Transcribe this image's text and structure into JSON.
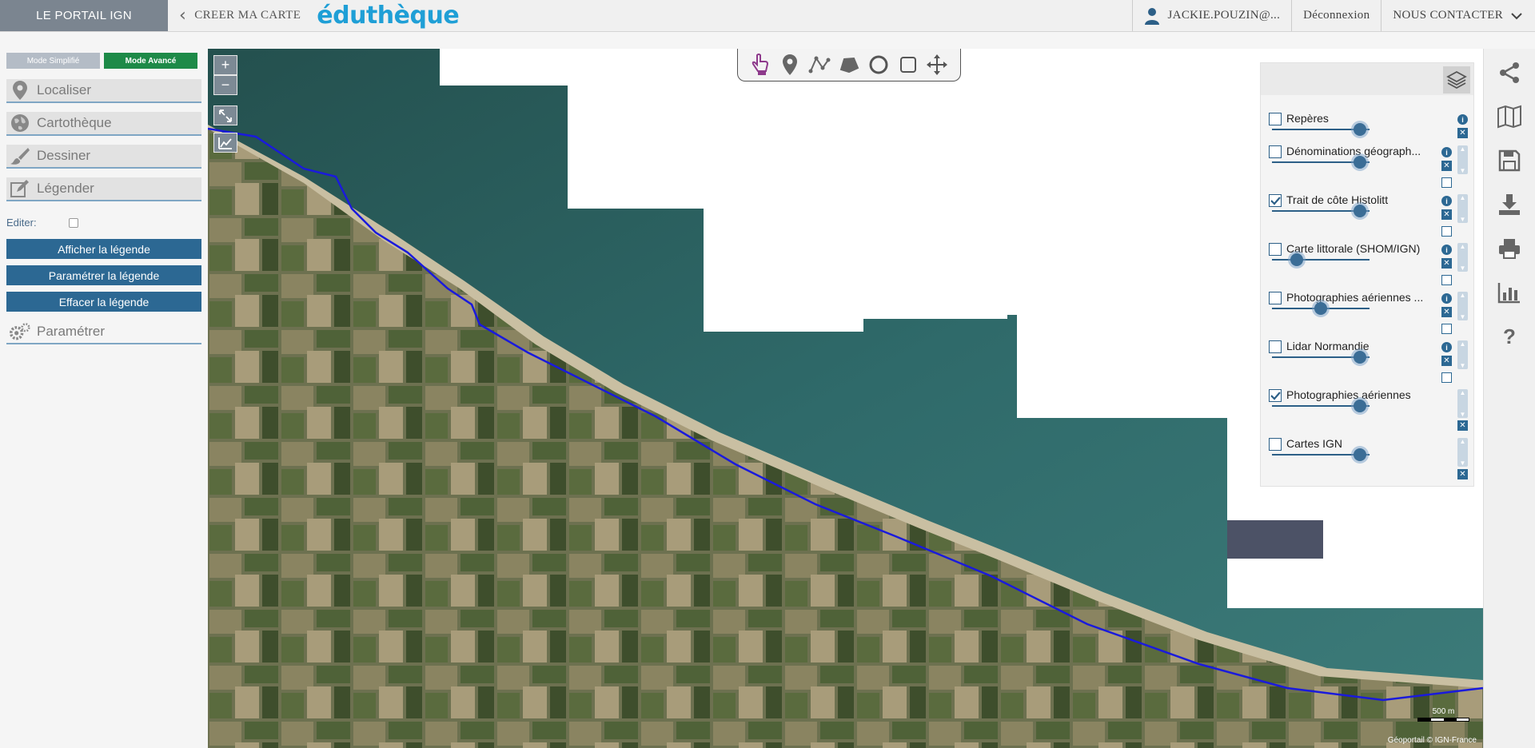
{
  "topbar": {
    "portal_label": "LE PORTAIL IGN",
    "create_label": "CREER MA CARTE",
    "brand": "éduthèque",
    "user": "JACKIE.POUZIN@...",
    "logout": "Déconnexion",
    "contact": "NOUS CONTACTER"
  },
  "left": {
    "mode_simple": "Mode Simplifié",
    "mode_advanced": "Mode Avancé",
    "menu": {
      "localiser": "Localiser",
      "cartotheque": "Cartothèque",
      "dessiner": "Dessiner",
      "legender": "Légender",
      "parametrer": "Paramétrer"
    },
    "editer_label": "Editer:",
    "buttons": {
      "afficher": "Afficher la légende",
      "parametrer": "Paramétrer la légende",
      "effacer": "Effacer la légende"
    }
  },
  "map": {
    "zoom_in": "+",
    "zoom_out": "−",
    "scale_label": "500 m",
    "attribution": "Géoportail © IGN-France"
  },
  "layers": [
    {
      "name": "Repères",
      "checked": false,
      "opacity": 0.9
    },
    {
      "name": "Dénominations géograph...",
      "checked": false,
      "opacity": 0.9
    },
    {
      "name": "Trait de côte Histolitt",
      "checked": true,
      "opacity": 0.9
    },
    {
      "name": "Carte littorale (SHOM/IGN)",
      "checked": false,
      "opacity": 0.25
    },
    {
      "name": "Photographies aériennes ...",
      "checked": false,
      "opacity": 0.5
    },
    {
      "name": "Lidar Normandie",
      "checked": false,
      "opacity": 0.9
    },
    {
      "name": "Photographies aériennes",
      "checked": true,
      "opacity": 0.9
    },
    {
      "name": "Cartes IGN",
      "checked": false,
      "opacity": 0.9
    }
  ],
  "colors": {
    "accent_blue": "#2c6893",
    "advanced_green": "#1d8a48",
    "brand_blue": "#1f9fd6",
    "coastline": "#1a1adc"
  },
  "icons": {
    "toolbar": [
      "pointer-hand-icon",
      "marker-icon",
      "polyline-icon",
      "polygon-icon",
      "circle-icon",
      "rectangle-icon",
      "move-icon"
    ],
    "rightbar": [
      "share-icon",
      "map-icon",
      "save-icon",
      "download-icon",
      "print-icon",
      "chart-icon",
      "help-icon"
    ]
  }
}
